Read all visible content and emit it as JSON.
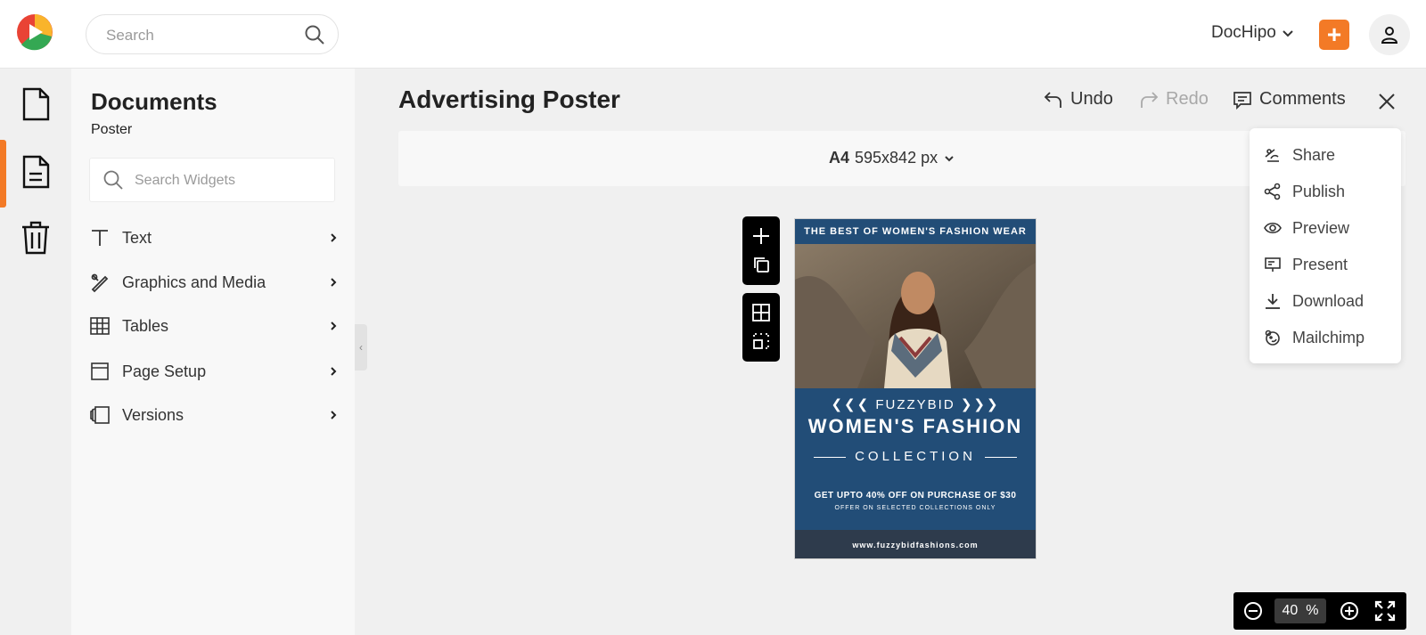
{
  "header": {
    "search_placeholder": "Search",
    "brand": "DocHipo"
  },
  "panel": {
    "title": "Documents",
    "subtitle": "Poster",
    "widget_search_placeholder": "Search Widgets",
    "items": [
      {
        "label": "Text"
      },
      {
        "label": "Graphics and Media"
      },
      {
        "label": "Tables"
      },
      {
        "label": "Page Setup"
      },
      {
        "label": "Versions"
      }
    ]
  },
  "editor": {
    "doc_title": "Advertising Poster",
    "undo_label": "Undo",
    "redo_label": "Redo",
    "comments_label": "Comments",
    "page_size_name": "A4",
    "page_size_dims": "595x842 px"
  },
  "poster": {
    "top_banner": "THE BEST OF WOMEN'S FASHION WEAR",
    "brand": "FUZZYBID",
    "headline": "WOMEN'S FASHION",
    "collection": "COLLECTION",
    "offer": "GET UPTO 40% OFF ON PURCHASE OF $30",
    "offer_note": "OFFER ON SELECTED COLLECTIONS ONLY",
    "website": "www.fuzzybidfashions.com"
  },
  "dropdown": {
    "items": [
      {
        "label": "Share"
      },
      {
        "label": "Publish"
      },
      {
        "label": "Preview"
      },
      {
        "label": "Present"
      },
      {
        "label": "Download"
      },
      {
        "label": "Mailchimp"
      }
    ]
  },
  "zoom": {
    "value": "40",
    "unit": "%"
  },
  "colors": {
    "accent": "#f37a26",
    "poster_blue": "#224d77",
    "poster_footer": "#2e3b4c"
  }
}
